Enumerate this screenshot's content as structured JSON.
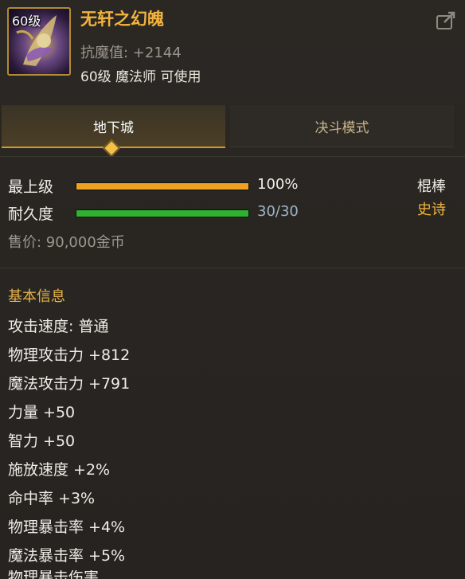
{
  "item": {
    "icon_level": "60级",
    "name": "无轩之幻魄",
    "resistance_line": "抗魔值: +2144",
    "requirement": "60级 魔法师 可使用"
  },
  "tabs": [
    {
      "label": "地下城",
      "active": true
    },
    {
      "label": "决斗模式",
      "active": false
    }
  ],
  "bars": [
    {
      "label": "最上级",
      "value_text": "100%",
      "fill": 1.0,
      "color": "#f0a020"
    },
    {
      "label": "耐久度",
      "value_text": "30/30",
      "fill": 1.0,
      "color": "#2fb22f"
    }
  ],
  "side": {
    "weapon_type": "棍棒",
    "rarity": "史诗",
    "rarity_color": "#f2b33d"
  },
  "price": "售价: 90,000金币",
  "basic_info": {
    "title": "基本信息",
    "stats": [
      "攻击速度: 普通",
      "物理攻击力 +812",
      "魔法攻击力 +791",
      "力量 +50",
      "智力 +50",
      "施放速度 +2%",
      "命中率 +3%",
      "物理暴击率 +4%",
      "魔法暴击率 +5%"
    ],
    "cut_line": "物理暴击伤害"
  },
  "icons": {
    "share": "share-icon",
    "item": "item-portrait-icon",
    "tab_marker": "diamond-marker-icon"
  }
}
